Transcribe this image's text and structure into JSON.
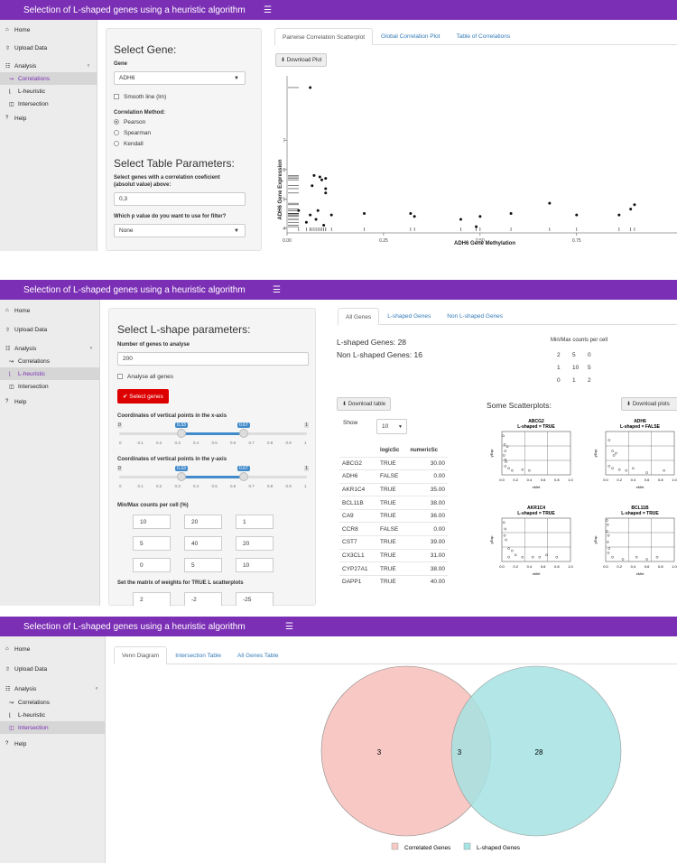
{
  "app_title": "Selection of L-shaped genes using a heuristic algorithm",
  "menu_icon": "hamburger-icon",
  "sidebar": {
    "home": "Home",
    "upload": "Upload Data",
    "analysis": "Analysis",
    "correlations": "Correlations",
    "lheuristic": "L-heuristic",
    "intersection": "Intersection",
    "help": "Help"
  },
  "p1": {
    "select_gene_title": "Select Gene:",
    "gene_label": "Gene",
    "gene_value": "ADH6",
    "smooth_label": "Smooth line (lm)",
    "method_label": "Correlation Method:",
    "methods": [
      "Pearson",
      "Spearman",
      "Kendall"
    ],
    "table_params_title": "Select Table Parameters:",
    "coef_label_1": "Select genes with a correlation coeficient",
    "coef_label_2": "(absolut value) above:",
    "coef_value": "0,3",
    "pval_label": "Which p value do you want to use for filter?",
    "pval_value": "None",
    "tabs": [
      "Pairwise Correlation Scatterplot",
      "Global Correlation Plot",
      "Table of Correlations"
    ],
    "download_plot": "Download Plot",
    "chart_data": {
      "type": "scatter",
      "xlabel": "ADH6 Gene Methylation",
      "ylabel": "ADH6 Gene Expression",
      "xticks": [
        "0.00",
        "0.25",
        "0.50",
        "0.75"
      ],
      "yticks": [
        "4",
        "5",
        "6",
        "7"
      ],
      "points": [
        [
          0.06,
          8.8
        ],
        [
          0.03,
          4.6
        ],
        [
          0.05,
          4.2
        ],
        [
          0.06,
          4.45
        ],
        [
          0.065,
          5.45
        ],
        [
          0.07,
          5.8
        ],
        [
          0.075,
          4.3
        ],
        [
          0.08,
          4.6
        ],
        [
          0.085,
          5.75
        ],
        [
          0.09,
          5.65
        ],
        [
          0.095,
          4.1
        ],
        [
          0.1,
          5.2
        ],
        [
          0.1,
          5.7
        ],
        [
          0.1,
          5.35
        ],
        [
          0.115,
          4.45
        ],
        [
          0.2,
          4.5
        ],
        [
          0.32,
          4.5
        ],
        [
          0.33,
          4.4
        ],
        [
          0.45,
          4.3
        ],
        [
          0.49,
          4.05
        ],
        [
          0.5,
          4.4
        ],
        [
          0.58,
          4.5
        ],
        [
          0.68,
          4.85
        ],
        [
          0.75,
          4.45
        ],
        [
          0.86,
          4.45
        ],
        [
          0.89,
          4.65
        ],
        [
          0.9,
          4.8
        ]
      ]
    }
  },
  "p2": {
    "title": "Select L-shape parameters:",
    "ngenes_label": "Number of genes to analyse",
    "ngenes_value": "200",
    "all_genes_label": "Analyse all genes",
    "select_btn": "Select genes",
    "xaxis_label": "Coordinates of vertical points in the x-axis",
    "yaxis_label": "Coordinates of vertical points in the y-axis",
    "slider_low": "0.33",
    "slider_high": "0.67",
    "slider_ticks": [
      "0",
      "0.1",
      "0.2",
      "0.3",
      "0.4",
      "0.5",
      "0.6",
      "0.7",
      "0.8",
      "0.9",
      "1"
    ],
    "slider_min": "0",
    "slider_max": "1",
    "minmax_label": "Min/Max counts per cell (%)",
    "minmax_values": [
      [
        "10",
        "20",
        "1"
      ],
      [
        "5",
        "40",
        "20"
      ],
      [
        "0",
        "5",
        "10"
      ]
    ],
    "weights_label": "Set the matrix of weights for TRUE L scatterplots",
    "weights_values": [
      "2",
      "-2",
      "-25"
    ],
    "tabs": [
      "All Genes",
      "L-shaped Genes",
      "Non L-shaped Genes"
    ],
    "lshaped_count": "L-shaped Genes: 28",
    "nonl_count": "Non L-shaped Genes: 16",
    "minmax_cell_title": "Min/Max counts per cell",
    "minmax_cell": [
      [
        "2",
        "5",
        "0"
      ],
      [
        "1",
        "10",
        "5"
      ],
      [
        "0",
        "1",
        "2"
      ]
    ],
    "download_table": "Download table",
    "show_label": "Show",
    "show_value": "10",
    "col_logic": "logicSc",
    "col_numeric": "numericSc",
    "rows": [
      [
        "ABCG2",
        "TRUE",
        "30.00"
      ],
      [
        "ADH6",
        "FALSE",
        "0.00"
      ],
      [
        "AKR1C4",
        "TRUE",
        "35.00"
      ],
      [
        "BCL11B",
        "TRUE",
        "38.00"
      ],
      [
        "CA9",
        "TRUE",
        "36.00"
      ],
      [
        "CCR8",
        "FALSE",
        "0.00"
      ],
      [
        "CST7",
        "TRUE",
        "39.00"
      ],
      [
        "CX3CL1",
        "TRUE",
        "31.00"
      ],
      [
        "CYP27A1",
        "TRUE",
        "38.00"
      ],
      [
        "DAPP1",
        "TRUE",
        "40.00"
      ]
    ],
    "scatter_title": "Some Scatterplots:",
    "download_plots": "Download plots",
    "mini_plots": [
      {
        "gene": "ABCG2",
        "status": "L-shaped =  TRUE"
      },
      {
        "gene": "ADH6",
        "status": "L-shaped =  FALSE"
      },
      {
        "gene": "AKR1C4",
        "status": "L-shaped =  TRUE"
      },
      {
        "gene": "BCL11B",
        "status": "L-shaped =  TRUE"
      }
    ],
    "mini_xlabel": "xMet",
    "mini_ylabel": "yExp",
    "mini_xticks": [
      "0.0",
      "0.2",
      "0.4",
      "0.6",
      "0.8",
      "1.0"
    ]
  },
  "p3": {
    "tabs": [
      "Venn Diagram",
      "Intersection Table",
      "All Genes Table"
    ],
    "left_count": "3",
    "mid_count": "3",
    "right_count": "28",
    "legend_a": "Correlated Genes",
    "legend_b": "L-shaped Genes",
    "color_a": "#f8c9c4",
    "color_b": "#a6e3e3"
  }
}
